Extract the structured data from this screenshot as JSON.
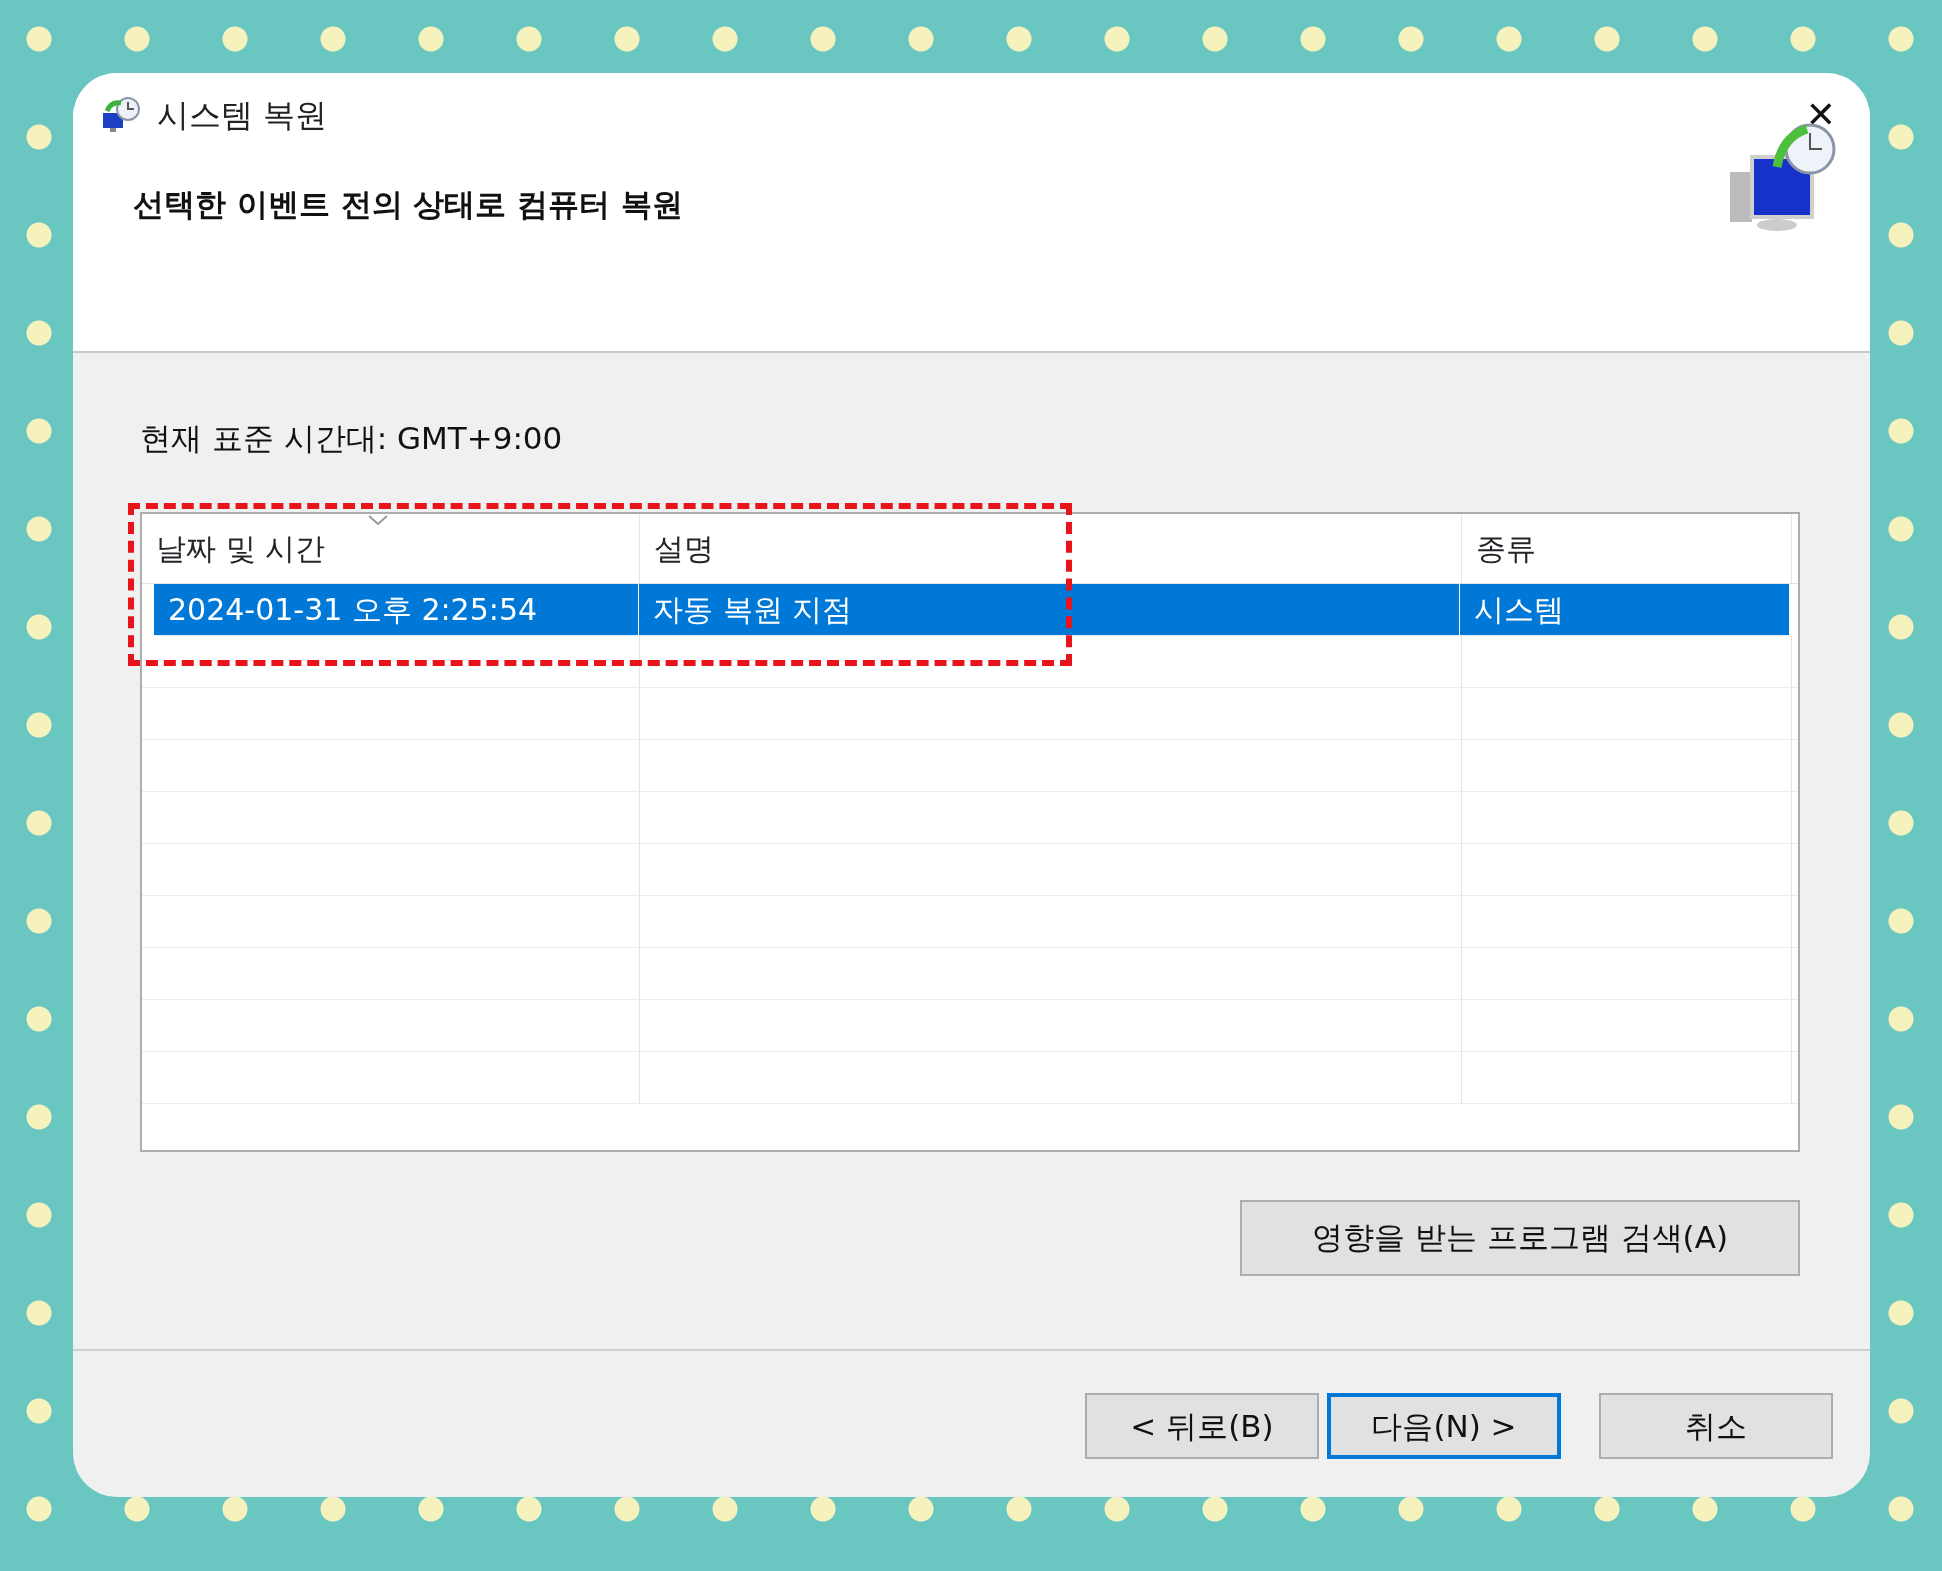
{
  "window": {
    "title": "시스템 복원",
    "close": "✕"
  },
  "header": {
    "heading": "선택한 이벤트 전의 상태로 컴퓨터 복원"
  },
  "timezone": "현재 표준 시간대: GMT+9:00",
  "table": {
    "columns": [
      {
        "label": "날짜 및 시간",
        "sorted": true
      },
      {
        "label": "설명",
        "sorted": false
      },
      {
        "label": "종류",
        "sorted": false
      }
    ],
    "rows": [
      {
        "cells": [
          "2024-01-31 오후 2:25:54",
          "자동 복원 지점",
          "시스템"
        ],
        "selected": true
      }
    ]
  },
  "scan_button": "영향을 받는 프로그램 검색(A)",
  "buttons": [
    {
      "label": "< 뒤로(B)",
      "default": false
    },
    {
      "label": "다음(N) >",
      "default": true
    },
    {
      "label": "취소",
      "default": false
    }
  ]
}
